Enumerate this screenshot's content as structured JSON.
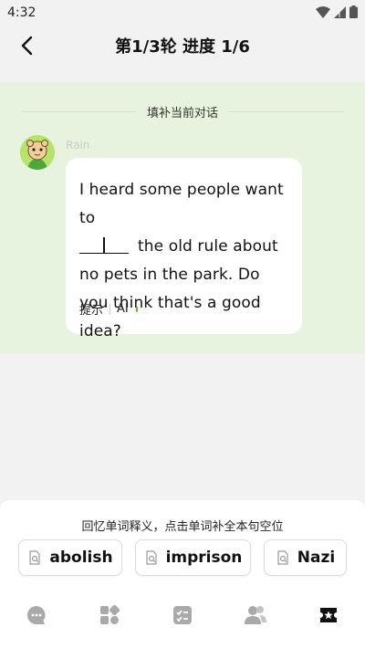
{
  "status": {
    "time": "4:32"
  },
  "header": {
    "title": "第1/3轮  进度 1/6"
  },
  "chat": {
    "section_label": "填补当前对话",
    "sender": "Rain",
    "message_before_blank": "I heard some people want to",
    "message_after_blank": "the old rule about no pets in the park. Do you think that's a good idea?",
    "hint_label": "提示",
    "ai_label": "AI"
  },
  "bottom": {
    "instruction": "回忆单词释义，点击单词补全本句空位",
    "options": [
      {
        "word": "abolish"
      },
      {
        "word": "imprison"
      },
      {
        "word": "Nazi"
      }
    ]
  },
  "tabs": [
    {
      "icon": "chat-bubble-icon",
      "active": false
    },
    {
      "icon": "grid-icon",
      "active": false
    },
    {
      "icon": "checklist-icon",
      "active": false
    },
    {
      "icon": "people-icon",
      "active": false
    },
    {
      "icon": "ticket-star-icon",
      "active": true
    }
  ],
  "colors": {
    "panel_bg": "#e8f3df",
    "accent_green": "#5ac12d",
    "tab_inactive": "#a9a9a9",
    "tab_active": "#111111"
  }
}
